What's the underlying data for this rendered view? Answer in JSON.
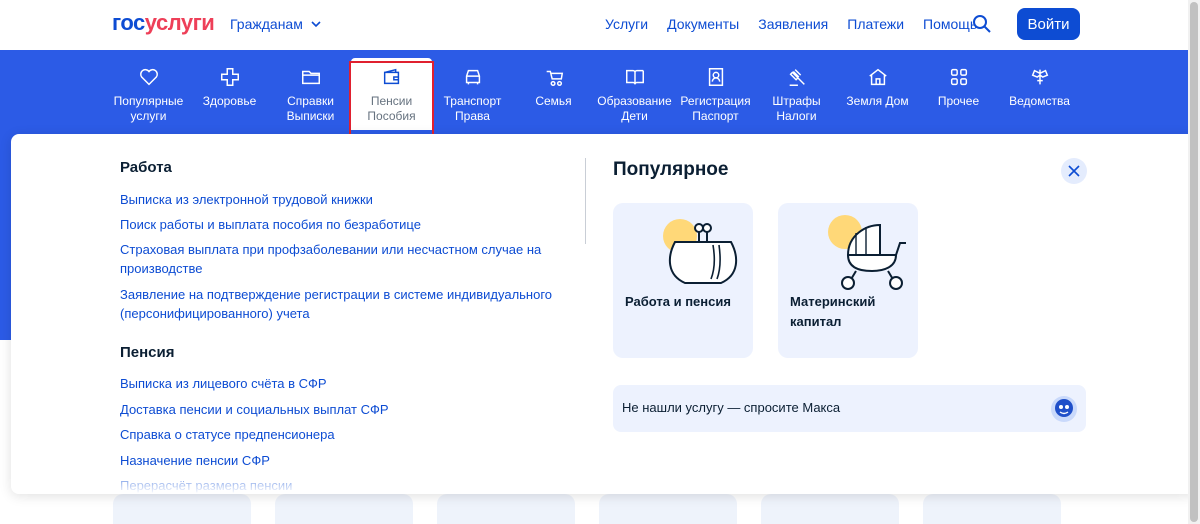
{
  "header": {
    "logo_part1": "гос",
    "logo_part2": "услуги",
    "audience": "Гражданам",
    "nav": [
      "Услуги",
      "Документы",
      "Заявления",
      "Платежи",
      "Помощь"
    ],
    "login": "Войти"
  },
  "categories": [
    {
      "line1": "Популярные",
      "line2": "услуги",
      "icon": "heart-icon"
    },
    {
      "line1": "Здоровье",
      "line2": "",
      "icon": "plus-cross-icon"
    },
    {
      "line1": "Справки",
      "line2": "Выписки",
      "icon": "folder-icon"
    },
    {
      "line1": "Пенсии",
      "line2": "Пособия",
      "icon": "wallet-icon"
    },
    {
      "line1": "Транспорт",
      "line2": "Права",
      "icon": "car-icon"
    },
    {
      "line1": "Семья",
      "line2": "",
      "icon": "stroller-icon"
    },
    {
      "line1": "Образование",
      "line2": "Дети",
      "icon": "book-icon"
    },
    {
      "line1": "Регистрация",
      "line2": "Паспорт",
      "icon": "id-card-icon"
    },
    {
      "line1": "Штрафы",
      "line2": "Налоги",
      "icon": "gavel-icon"
    },
    {
      "line1": "Земля Дом",
      "line2": "",
      "icon": "house-icon"
    },
    {
      "line1": "Прочее",
      "line2": "",
      "icon": "grid-icon"
    },
    {
      "line1": "Ведомства",
      "line2": "",
      "icon": "emblem-icon"
    }
  ],
  "panel": {
    "work_title": "Работа",
    "work_links": [
      "Выписка из электронной трудовой книжки",
      "Поиск работы и выплата пособия по безработице",
      "Страховая выплата при профзаболевании или несчастном случае на производстве",
      "Заявление на подтверждение регистрации в системе индивидуального (персонифицированного) учета"
    ],
    "pension_title": "Пенсия",
    "pension_links": [
      "Выписка из лицевого счёта в СФР",
      "Доставка пенсии и социальных выплат СФР",
      "Справка о статусе предпенсионера",
      "Назначение пенсии СФР",
      "Перерасчёт размера пенсии"
    ],
    "popular_title": "Популярное",
    "cards": [
      "Работа и пенсия",
      "Материнский капитал"
    ],
    "ask": "Не нашли услугу — спросите Макса"
  },
  "colors": {
    "brand_blue": "#0d4cd3",
    "band_blue": "#2c5be6",
    "brand_red": "#ee3f58",
    "highlight_red": "#e0202f"
  }
}
